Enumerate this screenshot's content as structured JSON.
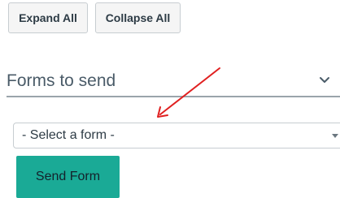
{
  "toolbar": {
    "expand_all_label": "Expand All",
    "collapse_all_label": "Collapse All"
  },
  "section": {
    "title": "Forms to send",
    "chevron_icon": "chevron-down-icon"
  },
  "form_select": {
    "selected_value": "- Select a form -",
    "arrow_icon": "dropdown-arrow-icon"
  },
  "send_button": {
    "label": "Send Form"
  },
  "colors": {
    "accent": "#1aaa96",
    "annotation_arrow": "#e02020"
  }
}
